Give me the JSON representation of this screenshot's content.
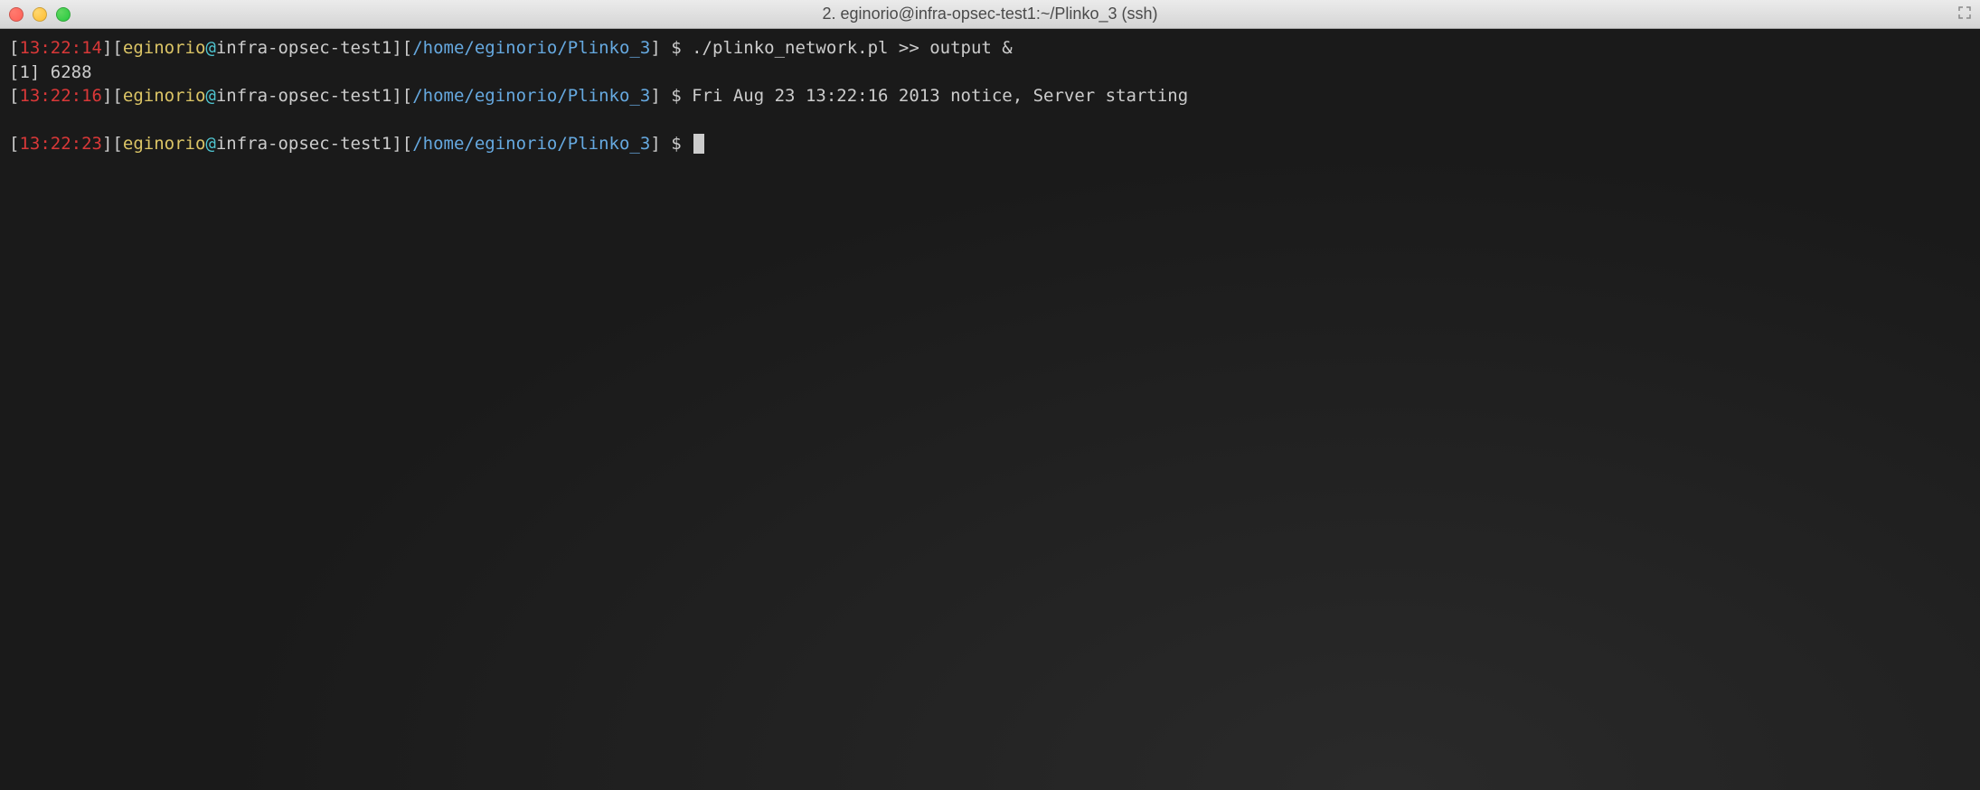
{
  "window": {
    "title": "2. eginorio@infra-opsec-test1:~/Plinko_3 (ssh)"
  },
  "lines": [
    {
      "type": "prompt",
      "time": "13:22:14",
      "user": "eginorio",
      "host": "infra-opsec-test1",
      "path": "/home/eginorio/Plinko_3",
      "command": "./plinko_network.pl >> output &"
    },
    {
      "type": "output",
      "text": "[1] 6288"
    },
    {
      "type": "prompt",
      "time": "13:22:16",
      "user": "eginorio",
      "host": "infra-opsec-test1",
      "path": "/home/eginorio/Plinko_3",
      "command": "Fri Aug 23 13:22:16 2013 notice, Server starting"
    },
    {
      "type": "blank"
    },
    {
      "type": "prompt",
      "time": "13:22:23",
      "user": "eginorio",
      "host": "infra-opsec-test1",
      "path": "/home/eginorio/Plinko_3",
      "command": "",
      "cursor": true
    }
  ]
}
